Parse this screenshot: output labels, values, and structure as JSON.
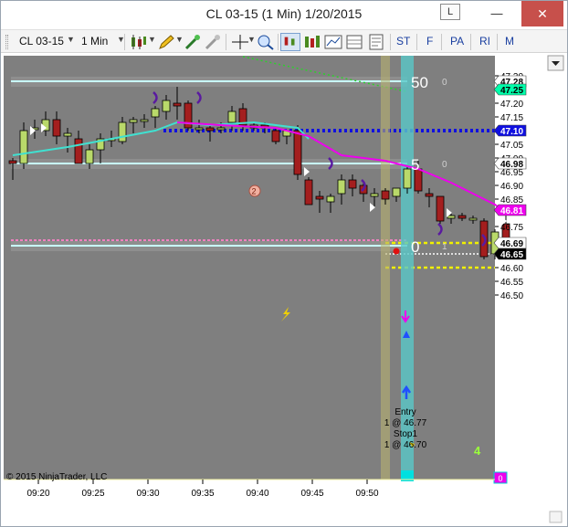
{
  "window": {
    "title": "CL 03-15 (1 Min)  1/20/2015",
    "layout_button": "L",
    "minimize": "—",
    "close": "✕"
  },
  "toolbar": {
    "instrument": "CL 03-15",
    "interval": "1 Min",
    "icons": [
      "candlestick-icon",
      "pencil-icon",
      "magic-wand-icon",
      "magic-wand-icon",
      "crosshair-icon",
      "zoom-icon",
      "strategy-icon",
      "bar-style-icon",
      "chart-properties-icon",
      "data-box-icon",
      "properties-icon"
    ],
    "buttons": [
      "ST",
      "F",
      "PA",
      "RI",
      "M"
    ]
  },
  "chart": {
    "copyright": "© 2015 NinjaTrader, LLC",
    "price_ticks": [
      "47.30",
      "47.20",
      "47.15",
      "47.05",
      "47.00",
      "46.95",
      "46.90",
      "46.85",
      "46.75",
      "46.60",
      "46.55",
      "46.50"
    ],
    "time_ticks": [
      "09:20",
      "09:25",
      "09:30",
      "09:35",
      "09:40",
      "09:45",
      "09:50"
    ],
    "price_tags": [
      {
        "price": 47.28,
        "label": "47.28",
        "bg": "#ffffff",
        "fg": "#000000"
      },
      {
        "price": 47.25,
        "label": "47.25",
        "bg": "#00ffaa",
        "fg": "#000000"
      },
      {
        "price": 47.1,
        "label": "47.10",
        "bg": "#1010e0",
        "fg": "#ffffff"
      },
      {
        "price": 46.98,
        "label": "46.98",
        "bg": "#ffffff",
        "fg": "#000000"
      },
      {
        "price": 46.81,
        "label": "46.81",
        "bg": "#ee00ee",
        "fg": "#ffffff"
      },
      {
        "price": 46.69,
        "label": "46.69",
        "bg": "#ffffff",
        "fg": "#000000"
      },
      {
        "price": 46.65,
        "label": "46.65",
        "bg": "#000000",
        "fg": "#ffffff"
      }
    ],
    "level_labels": [
      {
        "price": 47.28,
        "big": "50",
        "small": "0"
      },
      {
        "price": 46.98,
        "big": "5",
        "small": "0"
      },
      {
        "price": 46.68,
        "big": "0",
        "small": "1"
      }
    ],
    "trade_text": [
      "Entry",
      "1 @ 46.77",
      "Stop1",
      "1 @ 46.70"
    ],
    "counter": "4",
    "bottom_tag": "0",
    "colors": {
      "background": "#7f7f7f",
      "up_candle": "#b9d96a",
      "down_candle": "#a41e1e",
      "fast_ma": "#40e0d0",
      "slow_ma": "#ee00ee",
      "blue_level": "#1010e0",
      "yellow_level": "#f0f000"
    }
  },
  "chart_data": {
    "type": "candlestick",
    "title": "CL 03-15 (1 Min)  1/20/2015",
    "xlabel": "",
    "ylabel": "",
    "ylim": [
      46.46,
      47.33
    ],
    "x_ticks": [
      "09:20",
      "09:25",
      "09:30",
      "09:35",
      "09:40",
      "09:45",
      "09:50"
    ],
    "candles": [
      [
        46.99,
        47.0,
        46.92,
        46.98
      ],
      [
        46.98,
        47.13,
        46.96,
        47.1
      ],
      [
        47.11,
        47.14,
        47.07,
        47.11
      ],
      [
        47.1,
        47.17,
        47.08,
        47.14
      ],
      [
        47.14,
        47.17,
        47.05,
        47.08
      ],
      [
        47.08,
        47.11,
        47.02,
        47.09
      ],
      [
        47.07,
        47.1,
        46.98,
        46.98
      ],
      [
        46.98,
        47.05,
        46.96,
        47.03
      ],
      [
        47.03,
        47.09,
        46.98,
        47.07
      ],
      [
        47.07,
        47.1,
        47.04,
        47.07
      ],
      [
        47.06,
        47.15,
        47.05,
        47.13
      ],
      [
        47.13,
        47.15,
        47.09,
        47.14
      ],
      [
        47.14,
        47.16,
        47.11,
        47.14
      ],
      [
        47.15,
        47.19,
        47.11,
        47.18
      ],
      [
        47.17,
        47.23,
        47.14,
        47.21
      ],
      [
        47.2,
        47.26,
        47.14,
        47.19
      ],
      [
        47.2,
        47.21,
        47.1,
        47.11
      ],
      [
        47.11,
        47.14,
        47.09,
        47.11
      ],
      [
        47.11,
        47.12,
        47.06,
        47.1
      ],
      [
        47.11,
        47.13,
        47.09,
        47.11
      ],
      [
        47.13,
        47.19,
        47.1,
        47.17
      ],
      [
        47.18,
        47.2,
        47.1,
        47.12
      ],
      [
        47.11,
        47.13,
        47.1,
        47.12
      ],
      [
        47.12,
        47.13,
        47.09,
        47.11
      ],
      [
        47.1,
        47.11,
        47.05,
        47.06
      ],
      [
        47.08,
        47.1,
        47.05,
        47.1
      ],
      [
        47.1,
        47.12,
        46.92,
        46.94
      ],
      [
        46.92,
        46.93,
        46.83,
        46.83
      ],
      [
        46.86,
        46.88,
        46.8,
        46.85
      ],
      [
        46.84,
        46.87,
        46.8,
        46.86
      ],
      [
        46.87,
        46.94,
        46.83,
        46.92
      ],
      [
        46.92,
        46.94,
        46.86,
        46.89
      ],
      [
        46.9,
        46.91,
        46.84,
        46.87
      ],
      [
        46.86,
        46.89,
        46.82,
        46.87
      ],
      [
        46.88,
        46.89,
        46.83,
        46.85
      ],
      [
        46.86,
        46.89,
        46.84,
        46.89
      ],
      [
        46.89,
        46.97,
        46.87,
        46.96
      ],
      [
        46.96,
        46.99,
        46.87,
        46.88
      ],
      [
        46.87,
        46.89,
        46.82,
        46.86
      ],
      [
        46.86,
        46.86,
        46.76,
        46.77
      ],
      [
        46.78,
        46.8,
        46.76,
        46.79
      ],
      [
        46.79,
        46.8,
        46.77,
        46.78
      ],
      [
        46.78,
        46.79,
        46.76,
        46.78
      ],
      [
        46.77,
        46.78,
        46.63,
        46.64
      ],
      [
        46.65,
        46.74,
        46.63,
        46.73
      ],
      [
        46.76,
        46.79,
        46.64,
        46.65
      ]
    ],
    "fast_ma": [
      [
        0,
        47.01
      ],
      [
        5,
        47.04
      ],
      [
        9,
        47.07
      ],
      [
        13,
        47.1
      ],
      [
        15,
        47.13
      ],
      [
        18,
        47.12
      ],
      [
        22,
        47.13
      ],
      [
        26,
        47.11
      ],
      [
        27,
        47.07
      ]
    ],
    "slow_ma": [
      [
        15,
        47.13
      ],
      [
        19,
        47.12
      ],
      [
        24,
        47.11
      ],
      [
        27,
        47.08
      ],
      [
        30,
        47.01
      ],
      [
        34,
        46.99
      ],
      [
        37,
        46.96
      ],
      [
        40,
        46.91
      ],
      [
        42,
        46.87
      ],
      [
        44,
        46.83
      ],
      [
        45,
        46.8
      ]
    ],
    "levels": {
      "cyan": [
        47.28,
        46.98,
        46.68
      ],
      "blue": 47.1,
      "pink": 46.7,
      "yellow_dashed": [
        46.69,
        46.6
      ],
      "white_dotted": 46.65
    }
  }
}
